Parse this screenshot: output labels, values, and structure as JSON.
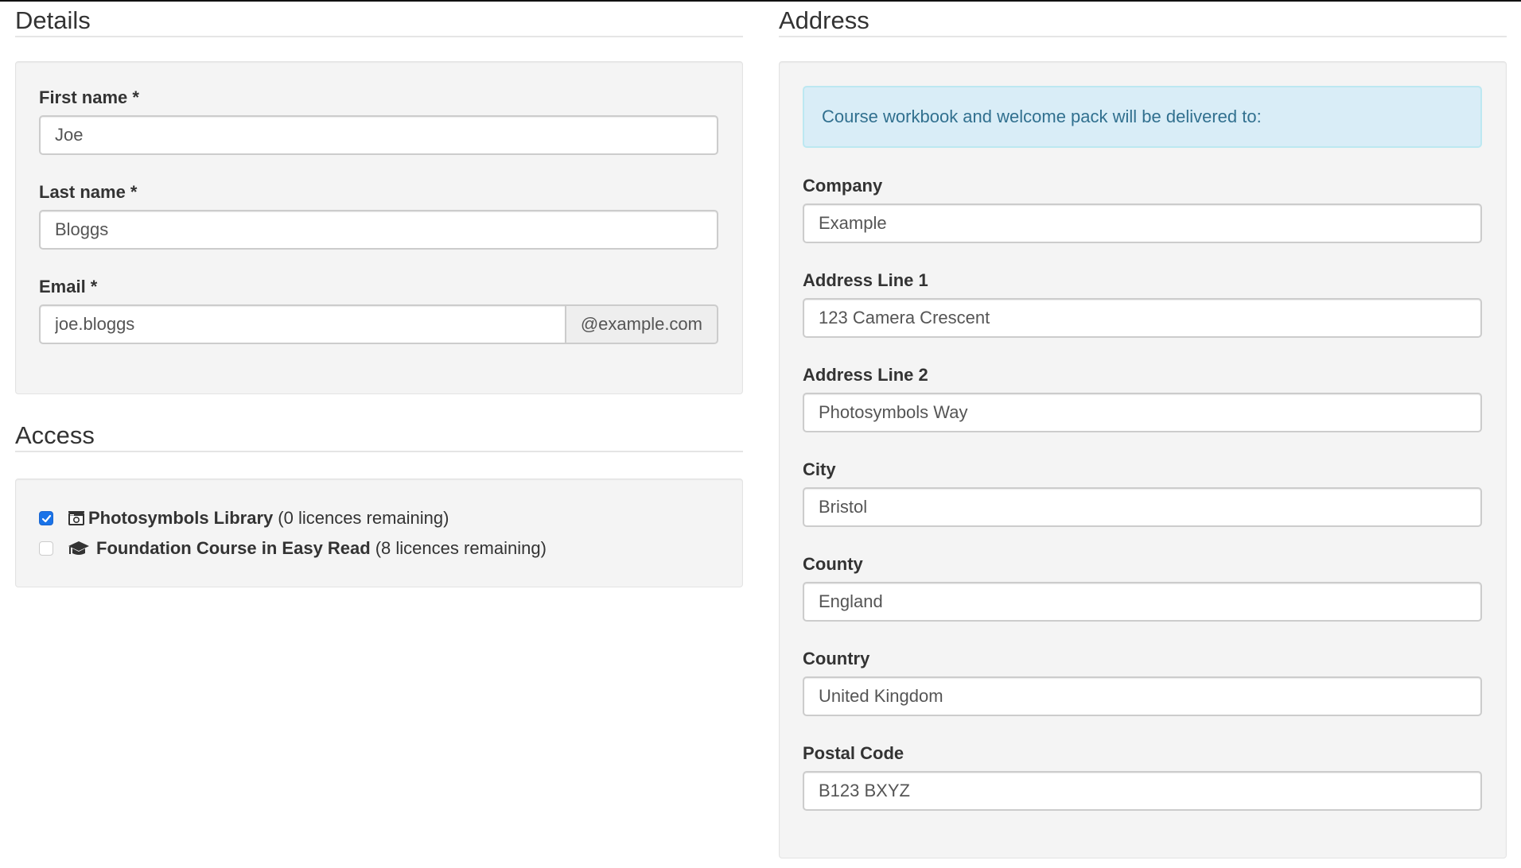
{
  "details": {
    "title": "Details",
    "fields": [
      {
        "label": "First name *",
        "value": "Joe"
      },
      {
        "label": "Last name *",
        "value": "Bloggs"
      },
      {
        "label": "Email *",
        "value": "joe.bloggs",
        "addon": "@example.com"
      }
    ]
  },
  "access": {
    "title": "Access",
    "items": [
      {
        "icon": "camera-icon",
        "name": "Photosymbols Library",
        "note": "(0 licences remaining)",
        "checked": true
      },
      {
        "icon": "graduation-cap-icon",
        "name": "Foundation Course in Easy Read",
        "note": "(8 licences remaining)",
        "checked": false
      }
    ]
  },
  "address": {
    "title": "Address",
    "notice": "Course workbook and welcome pack will be delivered to:",
    "fields": [
      {
        "label": "Company",
        "value": "Example"
      },
      {
        "label": "Address Line 1",
        "value": "123 Camera Crescent"
      },
      {
        "label": "Address Line 2",
        "value": "Photosymbols Way"
      },
      {
        "label": "City",
        "value": "Bristol"
      },
      {
        "label": "County",
        "value": "England"
      },
      {
        "label": "Country",
        "value": "United Kingdom"
      },
      {
        "label": "Postal Code",
        "value": "B123 BXYZ"
      }
    ]
  },
  "colors": {
    "info_bg": "#d9edf7",
    "info_border": "#bce8f1",
    "info_text": "#31708f",
    "checkbox_accent": "#1a73e8",
    "well_bg": "#f4f4f4"
  }
}
